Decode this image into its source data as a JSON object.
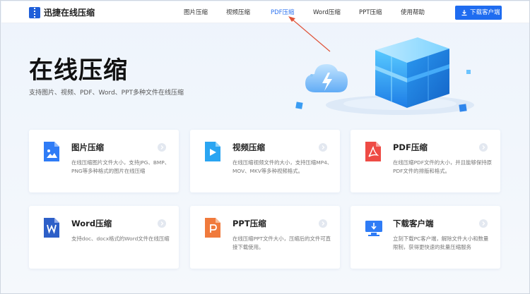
{
  "header": {
    "app_name": "迅捷在线压缩",
    "nav": [
      {
        "label": "图片压缩",
        "active": false
      },
      {
        "label": "视频压缩",
        "active": false
      },
      {
        "label": "PDF压缩",
        "active": true
      },
      {
        "label": "Word压缩",
        "active": false
      },
      {
        "label": "PPT压缩",
        "active": false
      },
      {
        "label": "使用帮助",
        "active": false
      }
    ],
    "download_label": "下载客户端"
  },
  "hero": {
    "title": "在线压缩",
    "subtitle": "支持图片、视频、PDF、Word、PPT多种文件在线压缩"
  },
  "cards": [
    {
      "title": "图片压缩",
      "icon": "image-file-icon",
      "desc": "在线压缩图片文件大小，支持JPG、BMP、PNG等多种格式的图片在线压缩"
    },
    {
      "title": "视频压缩",
      "icon": "video-file-icon",
      "desc": "在线压缩视频文件的大小，支持压缩MP4、MOV、MKV等多种视频格式。"
    },
    {
      "title": "PDF压缩",
      "icon": "pdf-file-icon",
      "desc": "在线压缩PDF文件的大小，并且能够保持原PDF文件的排版和格式。"
    },
    {
      "title": "Word压缩",
      "icon": "word-file-icon",
      "desc": "支持doc、docx格式的Word文件在线压缩"
    },
    {
      "title": "PPT压缩",
      "icon": "ppt-file-icon",
      "desc": "在线压缩PPT文件大小，压缩后的文件可直接下载使用。"
    },
    {
      "title": "下载客户端",
      "icon": "monitor-download-icon",
      "desc": "立刻下载PC客户端，解除文件大小和数量限制，获得更快速的批量压缩服务"
    }
  ],
  "colors": {
    "accent": "#1f6cf0",
    "nav_active": "#2e74f0",
    "image_icon": "#2f7cf6",
    "video_icon": "#2aa5f2",
    "pdf_icon": "#ee4b45",
    "word_icon": "#2d5fc8",
    "ppt_icon": "#f07a3c",
    "annotation_arrow": "#e0543a"
  }
}
